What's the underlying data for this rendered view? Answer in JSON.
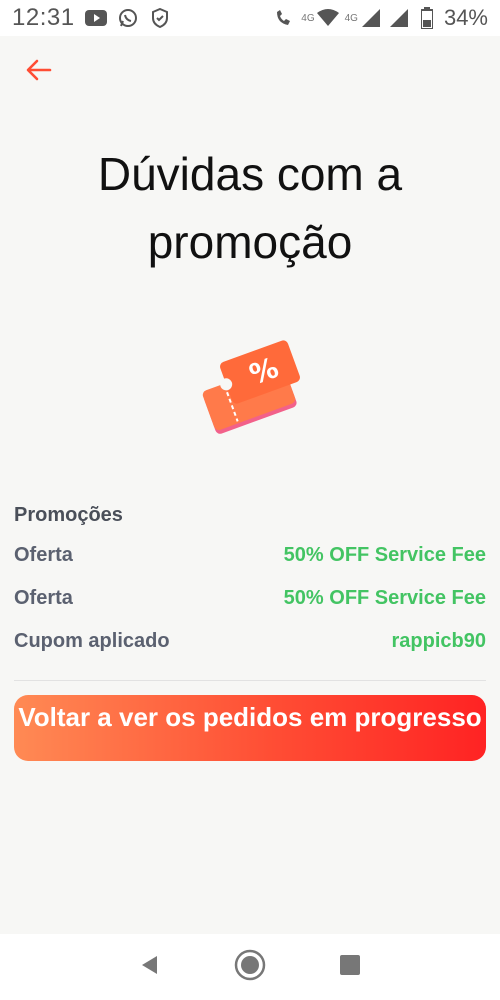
{
  "status_bar": {
    "time": "12:31",
    "battery_percent": "34%",
    "network_tag_1": "4G",
    "network_tag_2": "4G",
    "icons": [
      "youtube-icon",
      "whatsapp-icon",
      "shield-icon",
      "wifi-call-icon",
      "wifi-icon",
      "signal-icon",
      "signal-icon",
      "battery-icon"
    ]
  },
  "header": {
    "back_icon": "arrow-left-icon",
    "title": "Dúvidas com a promoção"
  },
  "illustration": {
    "icon": "discount-ticket-icon",
    "symbol": "%"
  },
  "promotions": {
    "heading": "Promoções",
    "rows": [
      {
        "label": "Oferta",
        "value": "50% OFF Service Fee"
      },
      {
        "label": "Oferta",
        "value": "50% OFF Service Fee"
      },
      {
        "label": "Cupom aplicado",
        "value": "rappicb90"
      }
    ]
  },
  "actions": {
    "back_to_orders_label": "Voltar a ver os pedidos em progresso"
  },
  "nav_bar": {
    "icons": [
      "back-triangle-icon",
      "home-circle-icon",
      "recents-square-icon"
    ]
  },
  "colors": {
    "accent": "#ff4d34",
    "value_green": "#43c463",
    "label_gray": "#5b6170"
  }
}
